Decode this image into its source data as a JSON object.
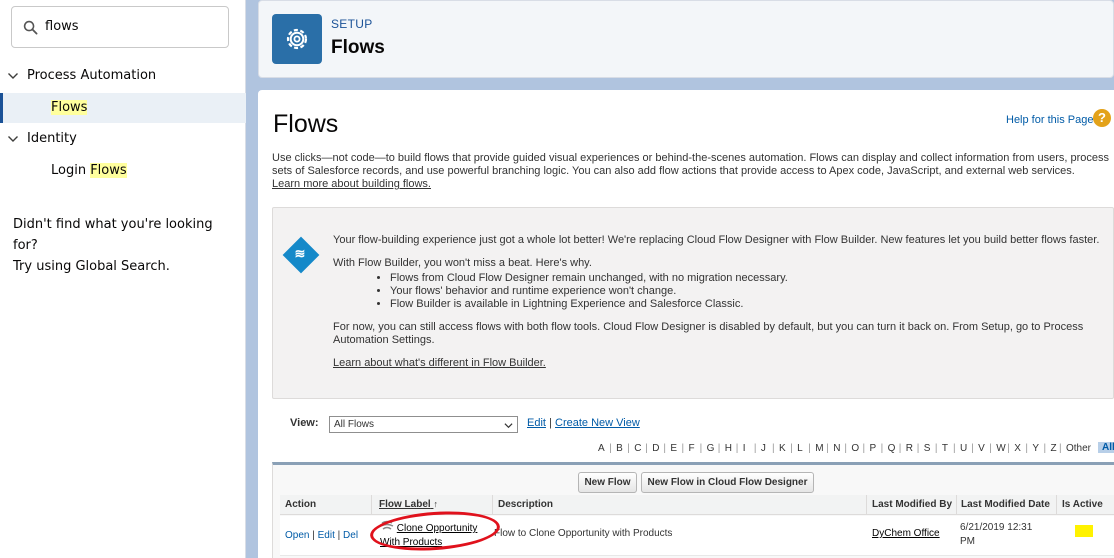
{
  "sidebar": {
    "search_value": "flows",
    "tree": [
      {
        "label": "Process Automation",
        "expanded": true
      },
      {
        "label_pre": "",
        "label_hl": "Flows",
        "selected": true
      },
      {
        "label": "Identity",
        "expanded": true
      },
      {
        "label_pre": "Login ",
        "label_hl": "Flows",
        "selected": false
      }
    ],
    "no_results_line1": "Didn't find what you're looking for?",
    "no_results_line2": "Try using Global Search."
  },
  "header": {
    "eyebrow": "SETUP",
    "title": "Flows",
    "icon": "gear-icon",
    "icon_bg": "#2a6fa8"
  },
  "main": {
    "title": "Flows",
    "help_link": "Help for this Page",
    "help_icon_char": "?",
    "intro": "Use clicks—not code—to build flows that provide guided visual experiences or behind-the-scenes automation. Flows can display and collect information from users, process sets of Salesforce records, and use powerful branching logic. You can also add flow actions that provide access to Apex code, JavaScript, and external web services.",
    "intro_link": "Learn more about building flows.",
    "info": {
      "icon": "flow-diamond-icon",
      "p1": "Your flow-building experience just got a whole lot better! We're replacing Cloud Flow Designer with Flow Builder. New features let you build better flows faster.",
      "p2": "With Flow Builder, you won't miss a beat. Here's why.",
      "bullets": [
        "Flows from Cloud Flow Designer remain unchanged, with no migration necessary.",
        "Your flows' behavior and runtime experience won't change.",
        "Flow Builder is available in Lightning Experience and Salesforce Classic."
      ],
      "p3": "For now, you can still access flows with both flow tools. Cloud Flow Designer is disabled by default, but you can turn it back on. From Setup, go to Process Automation Settings.",
      "link": "Learn about what's different in Flow Builder."
    },
    "view": {
      "label": "View:",
      "selected": "All Flows",
      "edit": "Edit",
      "separator": "|",
      "create": "Create New View"
    },
    "alphabet": [
      "A",
      "B",
      "C",
      "D",
      "E",
      "F",
      "G",
      "H",
      "I",
      "J",
      "K",
      "L",
      "M",
      "N",
      "O",
      "P",
      "Q",
      "R",
      "S",
      "T",
      "U",
      "V",
      "W",
      "X",
      "Y",
      "Z",
      "Other",
      "All"
    ],
    "buttons": {
      "new_flow": "New Flow",
      "new_flow_cfd": "New Flow in Cloud Flow Designer"
    },
    "table": {
      "headers": {
        "action": "Action",
        "label": "Flow Label",
        "sort_indicator": "↑",
        "description": "Description",
        "modified_by": "Last Modified By",
        "modified_date": "Last Modified Date",
        "is_active": "Is Active"
      },
      "rows": [
        {
          "open": "Open",
          "edit": "Edit",
          "del": "Del",
          "sep": "|",
          "label_line1": "Clone Opportunity",
          "label_line2": "With Products",
          "description": "Flow to Clone Opportunity with Products",
          "modified_by": "DyChem Office",
          "modified_date_line1": "6/21/2019 12:31",
          "modified_date_line2": "PM"
        }
      ]
    }
  },
  "colors": {
    "accent": "#1b5297",
    "link": "#015ba7",
    "highlight": "#ffff9d",
    "annotation_red": "#e0111c",
    "active_flag": "#fff200"
  }
}
